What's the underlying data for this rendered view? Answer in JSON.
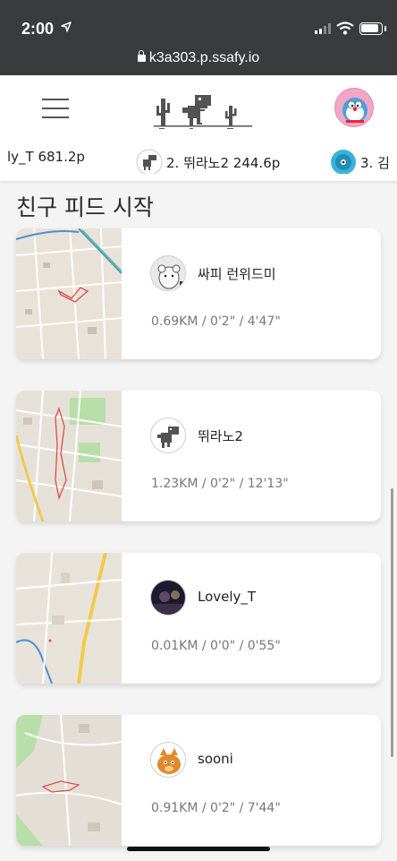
{
  "status_bar": {
    "time": "2:00",
    "url": "k3a303.p.ssafy.io"
  },
  "ranking": [
    {
      "label": "ly_T 681.2p"
    },
    {
      "label": "2. 뛰라노2 244.6p"
    },
    {
      "label": "3. 김"
    }
  ],
  "feed": {
    "title": "친구 피드 시작",
    "cards": [
      {
        "name": "싸피 런위드미",
        "stats": "0.69KM / 0'2\" / 4'47\""
      },
      {
        "name": "뛰라노2",
        "stats": "1.23KM / 0'2\" / 12'13\""
      },
      {
        "name": "Lovely_T",
        "stats": "0.01KM / 0'0\" / 0'55\""
      },
      {
        "name": "sooni",
        "stats": "0.91KM / 0'2\" / 7'44\""
      }
    ]
  },
  "colors": {
    "header_bg": "#3a3b3c",
    "card_bg": "#ffffff",
    "page_bg": "#f4f4f4",
    "route": "#e04a4a"
  }
}
